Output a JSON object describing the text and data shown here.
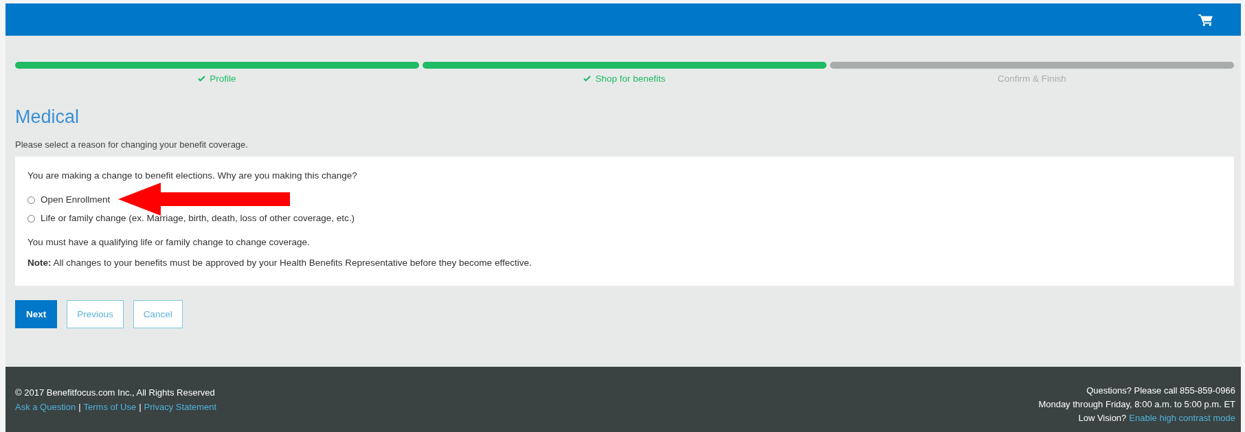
{
  "steps": [
    {
      "label": "Profile",
      "complete": true
    },
    {
      "label": "Shop for benefits",
      "complete": true
    },
    {
      "label": "Confirm & Finish",
      "complete": false
    }
  ],
  "title": "Medical",
  "subtitle": "Please select a reason for changing your benefit coverage.",
  "question": "You are making a change to benefit elections. Why are you making this change?",
  "options": [
    {
      "label": "Open Enrollment",
      "selected": false
    },
    {
      "label": "Life or family change (ex. Marriage, birth, death, loss of other coverage, etc.)",
      "selected": false
    }
  ],
  "info": "You must have a qualifying life or family change to change coverage.",
  "note": "**Note:** All changes to your benefits must be approved by your Health Benefits Representative before they become effective.",
  "buttons": [
    {
      "label": "Next",
      "kind": "primary"
    },
    {
      "label": "Previous",
      "kind": "secondary"
    },
    {
      "label": "Cancel",
      "kind": "secondary"
    }
  ],
  "footer": {
    "copyright": "© 2017 Benefitfocus.com Inc., All Rights Reserved",
    "links": [
      "Ask a Question",
      "Terms of Use",
      "Privacy Statement"
    ],
    "separator": "|",
    "phone": "Questions? Please call 855-859-0966",
    "hours": "Monday through Friday, 8:00 a.m. to 5:00 p.m. ET",
    "low_vision": "Low Vision?",
    "contrast_link": "Enable high contrast mode"
  }
}
